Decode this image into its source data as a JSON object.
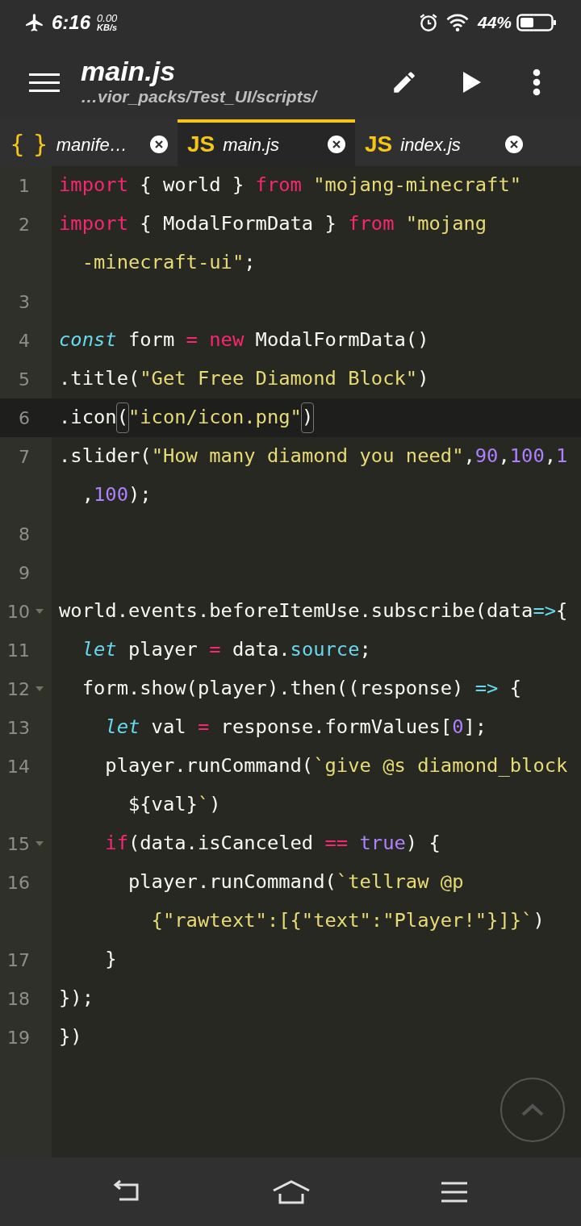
{
  "status_bar": {
    "time": "6:16",
    "speed_value": "0.00",
    "speed_unit": "KB/s",
    "battery": "44%"
  },
  "app_bar": {
    "title": "main.js",
    "path": "…vior_packs/Test_UI/scripts/"
  },
  "tabs": [
    {
      "kind": "json",
      "icon_text": "{ }",
      "label": "manife…",
      "selected": false
    },
    {
      "kind": "js",
      "icon_text": "JS",
      "label": "main.js",
      "selected": true
    },
    {
      "kind": "js",
      "icon_text": "JS",
      "label": "index.js",
      "selected": false
    }
  ],
  "code_lines": [
    {
      "number": "1",
      "foldable": false,
      "current": false,
      "tokens": [
        {
          "text": "import",
          "kind": "keyword"
        },
        {
          "text": " { world } ",
          "kind": "plain"
        },
        {
          "text": "from",
          "kind": "keyword"
        },
        {
          "text": " \"mojang-minecraft\"",
          "kind": "string"
        }
      ]
    },
    {
      "number": "2",
      "foldable": false,
      "current": false,
      "tokens": [
        {
          "text": "import",
          "kind": "keyword"
        },
        {
          "text": " { ModalFormData } ",
          "kind": "plain"
        },
        {
          "text": "from",
          "kind": "keyword"
        },
        {
          "text": " \"mojang",
          "kind": "string"
        }
      ],
      "continuation": [
        {
          "text": "  -minecraft-ui\"",
          "kind": "string"
        },
        {
          "text": ";",
          "kind": "plain"
        }
      ]
    },
    {
      "number": "3",
      "foldable": false,
      "current": false
    },
    {
      "number": "4",
      "foldable": false,
      "current": false,
      "tokens": [
        {
          "text": "const",
          "kind": "storage"
        },
        {
          "text": " form ",
          "kind": "plain"
        },
        {
          "text": "=",
          "kind": "operator"
        },
        {
          "text": " new",
          "kind": "keyword"
        },
        {
          "text": " ModalFormData()",
          "kind": "plain"
        }
      ]
    },
    {
      "number": "5",
      "foldable": false,
      "current": false,
      "tokens": [
        {
          "text": ".title(",
          "kind": "plain"
        },
        {
          "text": "\"Get Free Diamond Block\"",
          "kind": "string"
        },
        {
          "text": ")",
          "kind": "plain"
        }
      ]
    },
    {
      "number": "6",
      "foldable": false,
      "current": true,
      "tokens": [
        {
          "text": ".icon",
          "kind": "plain"
        },
        {
          "text": "(",
          "kind": "bracket-match"
        },
        {
          "text": "\"icon/icon.png\"",
          "kind": "string"
        },
        {
          "text": ")",
          "kind": "bracket-match"
        }
      ]
    },
    {
      "number": "7",
      "foldable": false,
      "current": false,
      "tokens": [
        {
          "text": ".slider(",
          "kind": "plain"
        },
        {
          "text": "\"How many diamond you need\"",
          "kind": "string"
        },
        {
          "text": ",",
          "kind": "plain"
        },
        {
          "text": "90",
          "kind": "number"
        },
        {
          "text": ",",
          "kind": "plain"
        },
        {
          "text": "100",
          "kind": "number"
        },
        {
          "text": ",",
          "kind": "plain"
        },
        {
          "text": "1",
          "kind": "number"
        }
      ],
      "continuation": [
        {
          "text": "  ,",
          "kind": "plain"
        },
        {
          "text": "100",
          "kind": "number"
        },
        {
          "text": ");",
          "kind": "plain"
        }
      ]
    },
    {
      "number": "8",
      "foldable": false,
      "current": false
    },
    {
      "number": "9",
      "foldable": false,
      "current": false
    },
    {
      "number": "10",
      "foldable": true,
      "current": false,
      "tokens": [
        {
          "text": "world.events.beforeItemUse.subscribe(data",
          "kind": "plain"
        },
        {
          "text": "=>",
          "kind": "arrow"
        },
        {
          "text": "{",
          "kind": "plain"
        }
      ]
    },
    {
      "number": "11",
      "foldable": false,
      "current": false,
      "tokens": [
        {
          "text": "  let",
          "kind": "storage"
        },
        {
          "text": " player ",
          "kind": "plain"
        },
        {
          "text": "=",
          "kind": "operator"
        },
        {
          "text": " data.",
          "kind": "plain"
        },
        {
          "text": "source",
          "kind": "property"
        },
        {
          "text": ";",
          "kind": "plain"
        }
      ]
    },
    {
      "number": "12",
      "foldable": true,
      "current": false,
      "tokens": [
        {
          "text": "  form.show(player).then((response) ",
          "kind": "plain"
        },
        {
          "text": "=>",
          "kind": "arrow"
        },
        {
          "text": " {",
          "kind": "plain"
        }
      ]
    },
    {
      "number": "13",
      "foldable": false,
      "current": false,
      "tokens": [
        {
          "text": "    let",
          "kind": "storage"
        },
        {
          "text": " val ",
          "kind": "plain"
        },
        {
          "text": "=",
          "kind": "operator"
        },
        {
          "text": " response.formValues[",
          "kind": "plain"
        },
        {
          "text": "0",
          "kind": "number"
        },
        {
          "text": "];",
          "kind": "plain"
        }
      ]
    },
    {
      "number": "14",
      "foldable": false,
      "current": false,
      "tokens": [
        {
          "text": "    player.runCommand(",
          "kind": "plain"
        },
        {
          "text": "`give @s diamond_block",
          "kind": "string"
        }
      ],
      "continuation": [
        {
          "text": "      ${val}",
          "kind": "plain"
        },
        {
          "text": "`",
          "kind": "string"
        },
        {
          "text": ")",
          "kind": "plain"
        }
      ]
    },
    {
      "number": "15",
      "foldable": true,
      "current": false,
      "tokens": [
        {
          "text": "    if",
          "kind": "keyword"
        },
        {
          "text": "(data.isCanceled ",
          "kind": "plain"
        },
        {
          "text": "==",
          "kind": "operator"
        },
        {
          "text": " true",
          "kind": "number"
        },
        {
          "text": ") {",
          "kind": "plain"
        }
      ]
    },
    {
      "number": "16",
      "foldable": false,
      "current": false,
      "tokens": [
        {
          "text": "      player.runCommand(",
          "kind": "plain"
        },
        {
          "text": "`tellraw @p",
          "kind": "string"
        }
      ],
      "continuation": [
        {
          "text": "        {\"rawtext\":[{\"text\":\"Player!\"}]}`",
          "kind": "string"
        },
        {
          "text": ")",
          "kind": "plain"
        }
      ]
    },
    {
      "number": "17",
      "foldable": false,
      "current": false,
      "tokens": [
        {
          "text": "    }",
          "kind": "plain"
        }
      ]
    },
    {
      "number": "18",
      "foldable": false,
      "current": false,
      "tokens": [
        {
          "text": "});",
          "kind": "plain"
        }
      ]
    },
    {
      "number": "19",
      "foldable": false,
      "current": false,
      "tokens": [
        {
          "text": "})",
          "kind": "plain"
        }
      ]
    }
  ]
}
